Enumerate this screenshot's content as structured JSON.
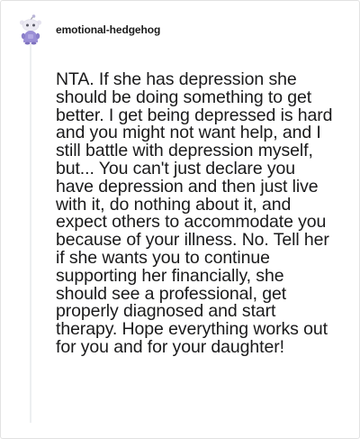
{
  "comment": {
    "author": "emotional-hedgehog",
    "avatar_icon": "snoo-avatar-icon",
    "body": "NTA. If she has depression she should be doing something to get better. I get being depressed is hard and you might not want help, and I still battle with depression myself, but... You can't just declare you have depression and then just live with it, do nothing about it, and expect others to accommodate you because of your illness. No. Tell her if she wants you to continue supporting her financially, she should see a professional, get properly diagnosed and start therapy. Hope everything works out for you and for your daughter!"
  },
  "colors": {
    "avatar_body": "#9b8fd6",
    "avatar_head": "#eceaf3",
    "thread_line": "#edeff1",
    "text": "#1a1a1b"
  }
}
